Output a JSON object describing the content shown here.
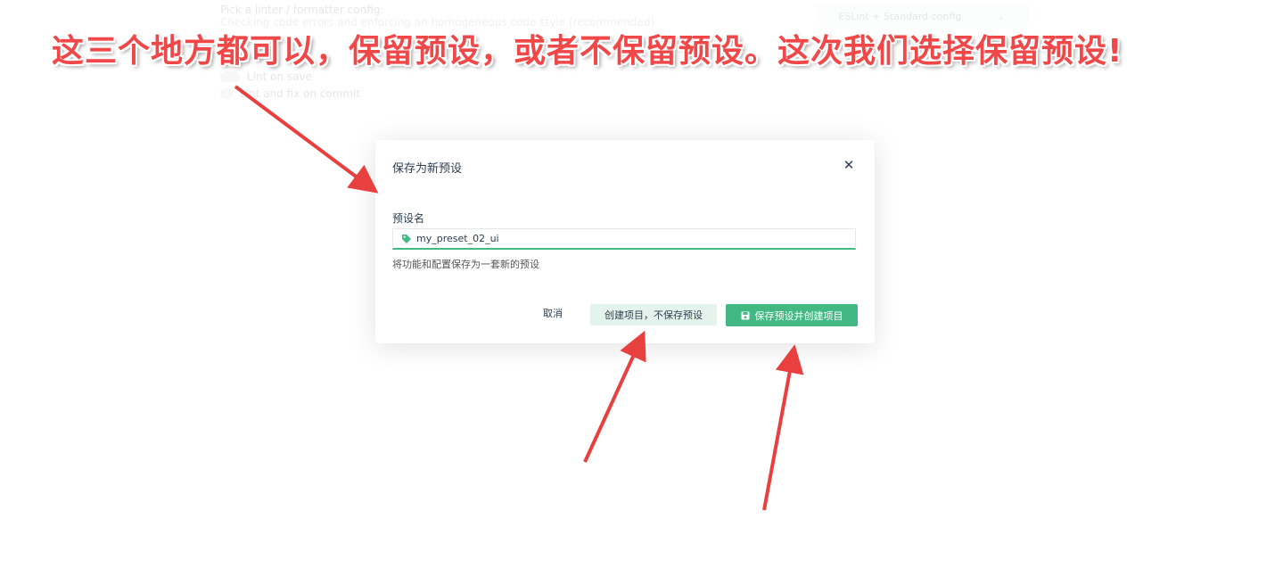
{
  "background": {
    "linter_label": "Pick a linter / formatter config:",
    "linter_desc": "Checking code errors and enforcing an homogeneous code style (recommended)",
    "linter_select_value": "ESLint + Standard config",
    "options": [
      {
        "label": "Lint on save"
      },
      {
        "label": "Lint and fix on commit"
      }
    ]
  },
  "modal": {
    "title": "保存为新预设",
    "close_icon": "close-icon",
    "field_label": "预设名",
    "input_value": "my_preset_02_ui",
    "input_icon": "tag-icon",
    "hint": "将功能和配置保存为一套新的预设",
    "cancel_label": "取消",
    "no_save_label": "创建项目，不保存预设",
    "save_label": "保存预设并创建项目",
    "save_icon": "save-icon"
  },
  "annotation": {
    "text": "这三个地方都可以，保留预设，或者不保留预设。这次我们选择保留预设!"
  },
  "colors": {
    "accent": "#42b983",
    "accent_light": "#e4f4ed",
    "annotation_red": "#f04848"
  }
}
